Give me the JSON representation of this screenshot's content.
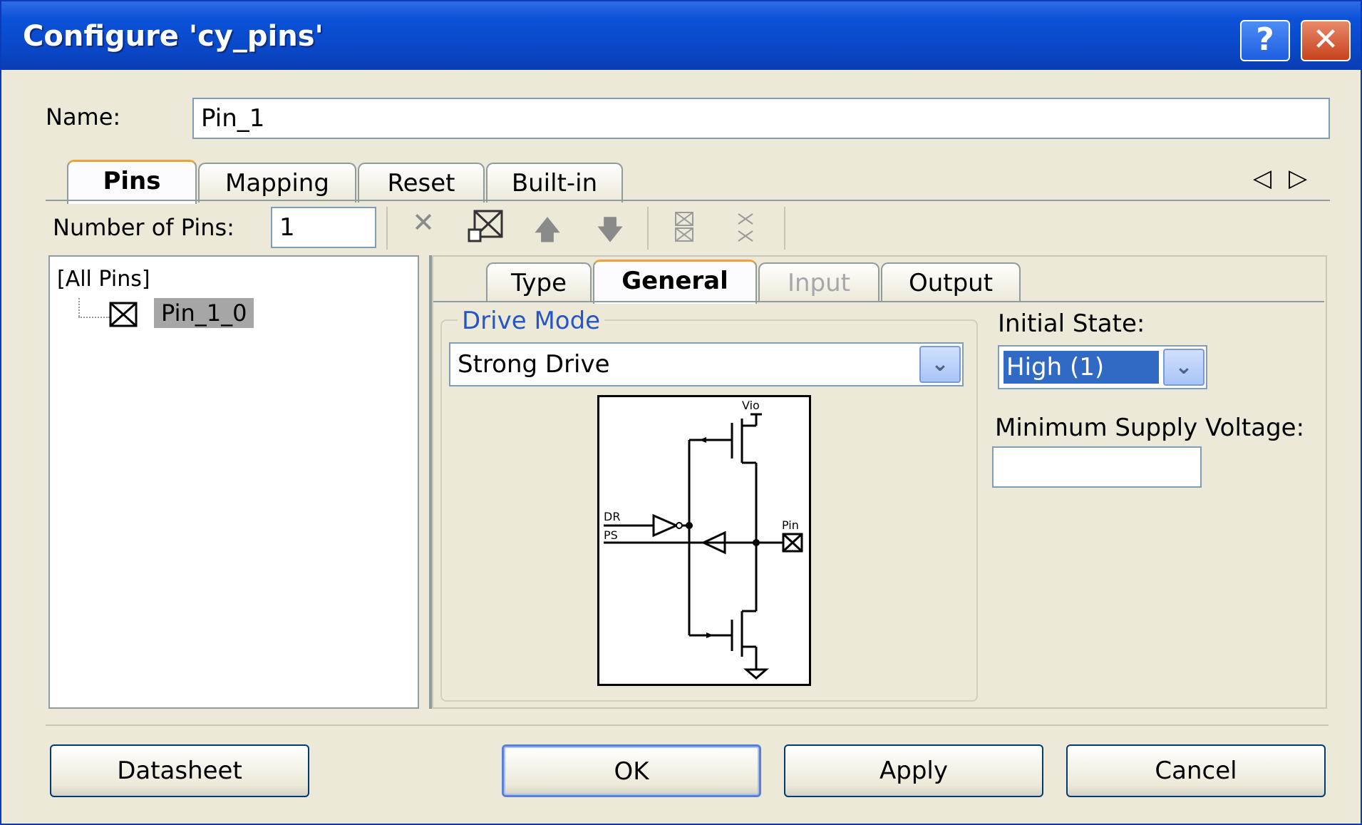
{
  "window": {
    "title": "Configure 'cy_pins'",
    "help_label": "?",
    "close_label": "✕"
  },
  "name_field": {
    "label": "Name:",
    "value": "Pin_1"
  },
  "main_tabs": [
    {
      "label": "Pins",
      "active": true
    },
    {
      "label": "Mapping"
    },
    {
      "label": "Reset"
    },
    {
      "label": "Built-in"
    }
  ],
  "tab_scroll": {
    "left": "◁",
    "right": "▷"
  },
  "toolbar": {
    "pins_label": "Number of Pins:",
    "pins_value": "1",
    "icons": [
      "delete-icon",
      "pin-select-icon",
      "move-up-icon",
      "move-down-icon",
      "split-pins-icon",
      "join-pins-icon"
    ]
  },
  "tree": {
    "root": "[All Pins]",
    "child": "Pin_1_0"
  },
  "sub_tabs": [
    {
      "label": "Type"
    },
    {
      "label": "General",
      "active": true
    },
    {
      "label": "Input",
      "disabled": true
    },
    {
      "label": "Output"
    }
  ],
  "drive_mode": {
    "group_label": "Drive Mode",
    "value": "Strong Drive",
    "diagram_labels": {
      "vio": "Vio",
      "dr": "DR",
      "ps": "PS",
      "pin": "Pin"
    }
  },
  "initial_state": {
    "label": "Initial State:",
    "value": "High (1)"
  },
  "min_voltage": {
    "label": "Minimum Supply Voltage:",
    "value": ""
  },
  "buttons": {
    "datasheet": "Datasheet",
    "ok": "OK",
    "apply": "Apply",
    "cancel": "Cancel"
  },
  "colors": {
    "title_bar": "#0a47c7",
    "selection": "#316ac5",
    "accent_blue": "#2456c6"
  }
}
